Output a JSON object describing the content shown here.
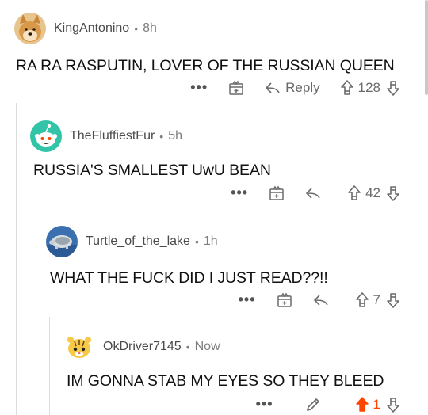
{
  "comments": [
    {
      "username": "KingAntonino",
      "time": "8h",
      "text": "RA RA RASPUTIN, LOVER OF THE RUSSIAN QUEEN",
      "reply_label": "Reply",
      "score": "128",
      "avatar": "doge-avatar"
    },
    {
      "username": "TheFluffiestFur",
      "time": "5h",
      "text": "RUSSIA'S SMALLEST UwU BEAN",
      "score": "42",
      "avatar": "snoo-avatar"
    },
    {
      "username": "Turtle_of_the_lake",
      "time": "1h",
      "text": "WHAT THE FUCK DID I JUST READ??!!",
      "score": "7",
      "avatar": "turtle-avatar"
    },
    {
      "username": "OkDriver7145",
      "time": "Now",
      "text": "IM GONNA STAB MY EYES SO THEY BLEED",
      "score": "1",
      "avatar": "tiger-snoo-avatar"
    }
  ],
  "separator": "•",
  "more_label": "•••",
  "colors": {
    "upvote_active": "#ff4500",
    "meta": "#7c7c7c",
    "text": "#111111"
  }
}
